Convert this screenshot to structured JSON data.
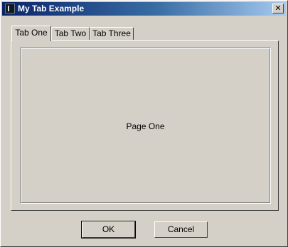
{
  "window": {
    "title": "My Tab Example",
    "close_glyph": "✕"
  },
  "tabs": [
    {
      "label": "Tab One",
      "active": true
    },
    {
      "label": "Tab Two",
      "active": false
    },
    {
      "label": "Tab Three",
      "active": false
    }
  ],
  "page": {
    "label": "Page One"
  },
  "buttons": {
    "ok_label": "OK",
    "cancel_label": "Cancel"
  },
  "colors": {
    "title_gradient_start": "#0a246a",
    "title_gradient_end": "#a6caf0",
    "face": "#d4d0c8"
  }
}
